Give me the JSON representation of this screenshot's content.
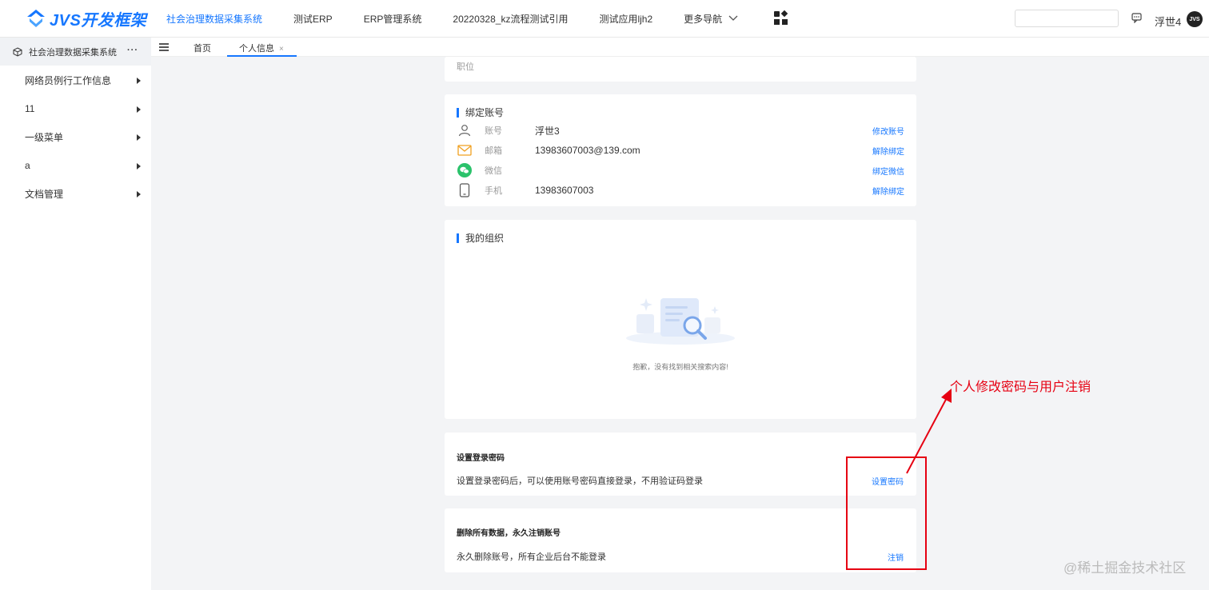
{
  "header": {
    "brand": "JVS开发框架",
    "nav": [
      {
        "label": "社会治理数据采集系统",
        "active": true
      },
      {
        "label": "测试ERP",
        "active": false
      },
      {
        "label": "ERP管理系统",
        "active": false
      },
      {
        "label": "20220328_kz流程测试引用",
        "active": false
      },
      {
        "label": "测试应用ljh2",
        "active": false
      }
    ],
    "more_label": "更多导航",
    "search_placeholder": "",
    "user_name": "浮世4",
    "avatar_text": "JVS",
    "accent_color": "#1677ff"
  },
  "sidebar": {
    "app_title": "社会治理数据采集系统",
    "more": "···",
    "items": [
      {
        "label": "网络员例行工作信息"
      },
      {
        "label": "11"
      },
      {
        "label": "一级菜单"
      },
      {
        "label": "a"
      },
      {
        "label": "文档管理"
      }
    ]
  },
  "tabs": [
    {
      "label": "首页",
      "active": false
    },
    {
      "label": "个人信息",
      "active": true,
      "close": "×"
    }
  ],
  "position_card": {
    "label": "职位"
  },
  "bind_card": {
    "title": "绑定账号",
    "rows": [
      {
        "icon": "user-icon",
        "label": "账号",
        "value": "浮世3",
        "action": "修改账号"
      },
      {
        "icon": "mail-icon",
        "label": "邮箱",
        "value": "13983607003@139.com",
        "action": "解除绑定"
      },
      {
        "icon": "wechat-icon",
        "label": "微信",
        "value": "",
        "action": "绑定微信"
      },
      {
        "icon": "phone-icon",
        "label": "手机",
        "value": "13983607003",
        "action": "解除绑定"
      }
    ]
  },
  "org_card": {
    "title": "我的组织",
    "empty_text": "抱歉，没有找到相关搜索内容!"
  },
  "password_card": {
    "title": "设置登录密码",
    "desc": "设置登录密码后，可以使用账号密码直接登录，不用验证码登录",
    "action": "设置密码"
  },
  "cancel_card": {
    "title": "删除所有数据，永久注销账号",
    "desc": "永久删除账号，所有企业后台不能登录",
    "action": "注销"
  },
  "annotation": {
    "text": "个人修改密码与用户注销",
    "color": "#e60012"
  },
  "watermark": "@稀土掘金技术社区"
}
